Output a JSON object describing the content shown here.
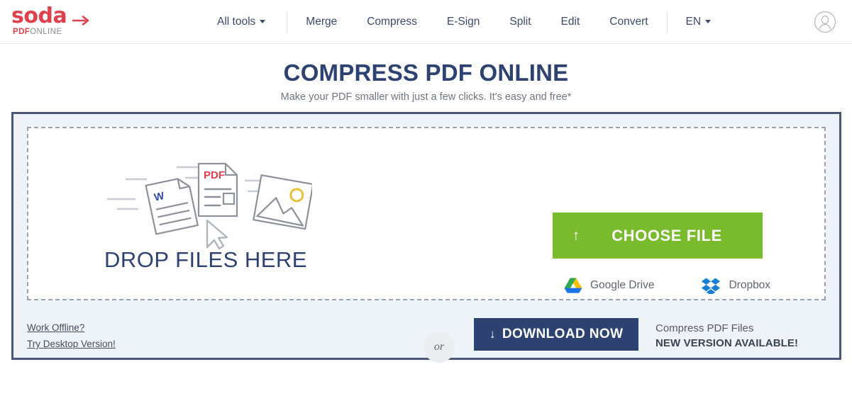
{
  "header": {
    "logo": {
      "word": "soda",
      "sub_bold": "PDF",
      "sub_light": "ONLINE",
      "arrow_icon": "right-arrow-icon"
    },
    "nav": [
      {
        "label": "All tools",
        "has_caret": true
      },
      {
        "label": "Merge",
        "has_caret": false
      },
      {
        "label": "Compress",
        "has_caret": false
      },
      {
        "label": "E-Sign",
        "has_caret": false
      },
      {
        "label": "Split",
        "has_caret": false
      },
      {
        "label": "Edit",
        "has_caret": false
      },
      {
        "label": "Convert",
        "has_caret": false
      }
    ],
    "language": {
      "label": "EN",
      "has_caret": true
    },
    "account_icon": "user-avatar-icon"
  },
  "hero": {
    "title": "COMPRESS PDF ONLINE",
    "subtitle": "Make your PDF smaller with just a few clicks. It's easy and free*"
  },
  "dropzone": {
    "drop_text": "DROP FILES HERE",
    "illustration_icons": [
      "word-document-icon",
      "pdf-document-icon",
      "image-file-icon",
      "cursor-arrow-icon"
    ],
    "pdf_badge_text": "PDF",
    "word_badge_text": "W"
  },
  "upload": {
    "or_label": "or",
    "choose_file_label": "CHOOSE FILE",
    "choose_file_arrow": "↑",
    "cloud_sources": [
      {
        "label": "Google Drive",
        "icon": "google-drive-icon"
      },
      {
        "label": "Dropbox",
        "icon": "dropbox-icon"
      }
    ]
  },
  "footer": {
    "offline_links": [
      "Work Offline?",
      "Try Desktop Version!"
    ],
    "download_label": "DOWNLOAD NOW",
    "download_arrow": "↓",
    "version_line1": "Compress PDF Files",
    "version_line2": "NEW VERSION AVAILABLE!"
  },
  "colors": {
    "brand_red": "#e0404c",
    "navy": "#2e4272",
    "green": "#7abb2e",
    "panel_bg": "#eef3fa",
    "panel_border": "#4a5878"
  }
}
